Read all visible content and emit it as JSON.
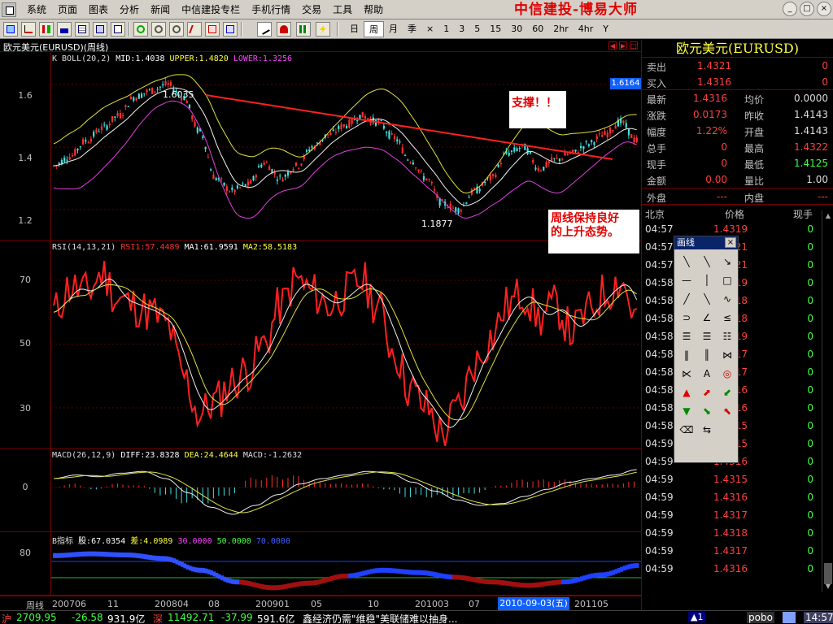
{
  "menu": {
    "items": [
      "系统",
      "页面",
      "图表",
      "分析",
      "新闻",
      "中信建投专栏",
      "手机行情",
      "交易",
      "工具",
      "帮助"
    ],
    "brand": "中信建投-博易大师",
    "window_buttons": [
      "_",
      "□",
      "×"
    ]
  },
  "toolbar": {
    "periods": [
      "日",
      "周",
      "月",
      "季",
      "×",
      "1",
      "3",
      "5",
      "15",
      "30",
      "60",
      "2hr",
      "4hr",
      "Y"
    ],
    "active_period": "周"
  },
  "chart": {
    "window_title": "欧元美元(EURUSD)(周线)",
    "price_badge": "1.6164",
    "boll": {
      "label": "K  BOLL(20,2)",
      "mid": "MID:1.4038",
      "upper": "UPPER:1.4820",
      "lower": "LOWER:1.3256",
      "y_labels": [
        "1.6",
        "1.4",
        "1.2"
      ],
      "high_label": "1.6035",
      "low_label": "1.1877"
    },
    "rsi": {
      "label": "RSI(14,13,21)",
      "rsi1": "RSI1:57.4489",
      "ma1": "MA1:61.9591",
      "ma2": "MA2:58.5183",
      "y_labels": [
        "70",
        "50",
        "30"
      ]
    },
    "macd": {
      "label": "MACD(26,12,9)",
      "diff": "DIFF:23.8328",
      "dea": "DEA:24.4644",
      "macd": "MACD:-1.2632",
      "y_labels": [
        "0"
      ]
    },
    "bind": {
      "label": "B指标",
      "gu": "股:67.0354",
      "cha": "差:4.0989",
      "v30": "30.0000",
      "v50": "50.0000",
      "v70": "70.0000",
      "y_labels": [
        "80"
      ]
    },
    "x_axis": {
      "prefix": "周线",
      "labels": [
        "200706",
        "11",
        "200804",
        "08",
        "200901",
        "05",
        "10",
        "201003",
        "07",
        "201105"
      ],
      "cursor_date": "2010-09-03(五)"
    },
    "notes": {
      "support": "支撑！！",
      "trend_line1": "周线保持良好",
      "trend_line2": "的上升态势。"
    }
  },
  "quote": {
    "title": "欧元美元(EURUSD)",
    "sell": {
      "label": "卖出",
      "price": "1.4321",
      "qty": "0"
    },
    "buy": {
      "label": "买入",
      "price": "1.4316",
      "qty": "0"
    },
    "rows": [
      {
        "k": "最新",
        "v": "1.4316",
        "k2": "均价",
        "v2": "0.0000",
        "c2": "#ddd"
      },
      {
        "k": "涨跌",
        "v": "0.0173",
        "k2": "昨收",
        "v2": "1.4143",
        "c2": "#ddd"
      },
      {
        "k": "幅度",
        "v": "1.22%",
        "k2": "开盘",
        "v2": "1.4143",
        "c2": "#ddd"
      },
      {
        "k": "总手",
        "v": "0",
        "k2": "最高",
        "v2": "1.4322",
        "c2": "#ff4040"
      },
      {
        "k": "现手",
        "v": "0",
        "k2": "最低",
        "v2": "1.4125",
        "c2": "#40ff40"
      },
      {
        "k": "金额",
        "v": "0.00",
        "k2": "量比",
        "v2": "1.00",
        "c2": "#ddd"
      }
    ],
    "outer": {
      "label": "外盘",
      "value": "---"
    },
    "inner": {
      "label": "内盘",
      "value": "---"
    },
    "tick_headers": [
      "北京",
      "价格",
      "现手"
    ],
    "ticks": [
      {
        "t": "04:57",
        "p": "1.4319",
        "q": "0"
      },
      {
        "t": "04:57",
        "p": "1.4321",
        "q": "0"
      },
      {
        "t": "04:57",
        "p": "1.4321",
        "q": "0"
      },
      {
        "t": "04:58",
        "p": "1.4319",
        "q": "0"
      },
      {
        "t": "04:58",
        "p": "1.4318",
        "q": "0"
      },
      {
        "t": "04:58",
        "p": "1.4318",
        "q": "0"
      },
      {
        "t": "04:58",
        "p": "1.4319",
        "q": "0"
      },
      {
        "t": "04:58",
        "p": "1.4317",
        "q": "0"
      },
      {
        "t": "04:58",
        "p": "1.4317",
        "q": "0"
      },
      {
        "t": "04:58",
        "p": "1.4316",
        "q": "0"
      },
      {
        "t": "04:58",
        "p": "1.4316",
        "q": "0"
      },
      {
        "t": "04:58",
        "p": "1.4315",
        "q": "0"
      },
      {
        "t": "04:59",
        "p": "1.4315",
        "q": "0"
      },
      {
        "t": "04:59",
        "p": "1.4316",
        "q": "0"
      },
      {
        "t": "04:59",
        "p": "1.4315",
        "q": "0"
      },
      {
        "t": "04:59",
        "p": "1.4316",
        "q": "0"
      },
      {
        "t": "04:59",
        "p": "1.4317",
        "q": "0"
      },
      {
        "t": "04:59",
        "p": "1.4318",
        "q": "0"
      },
      {
        "t": "04:59",
        "p": "1.4317",
        "q": "0"
      },
      {
        "t": "04:59",
        "p": "1.4316",
        "q": "0"
      }
    ]
  },
  "palette": {
    "title": "画线",
    "close": "×",
    "text_tool": "A"
  },
  "status": {
    "sh_label": "沪",
    "sh_index": "2709.95",
    "sh_change": "-26.58",
    "sh_amount": "931.9亿",
    "sz_label": "深",
    "sz_index": "11492.71",
    "sz_change": "-37.99",
    "sz_amount": "591.6亿",
    "news": "鑫经济仍需\"维稳\"美联储难以抽身...",
    "alert": "▲1",
    "brand": "pobo",
    "time": "14:57"
  }
}
